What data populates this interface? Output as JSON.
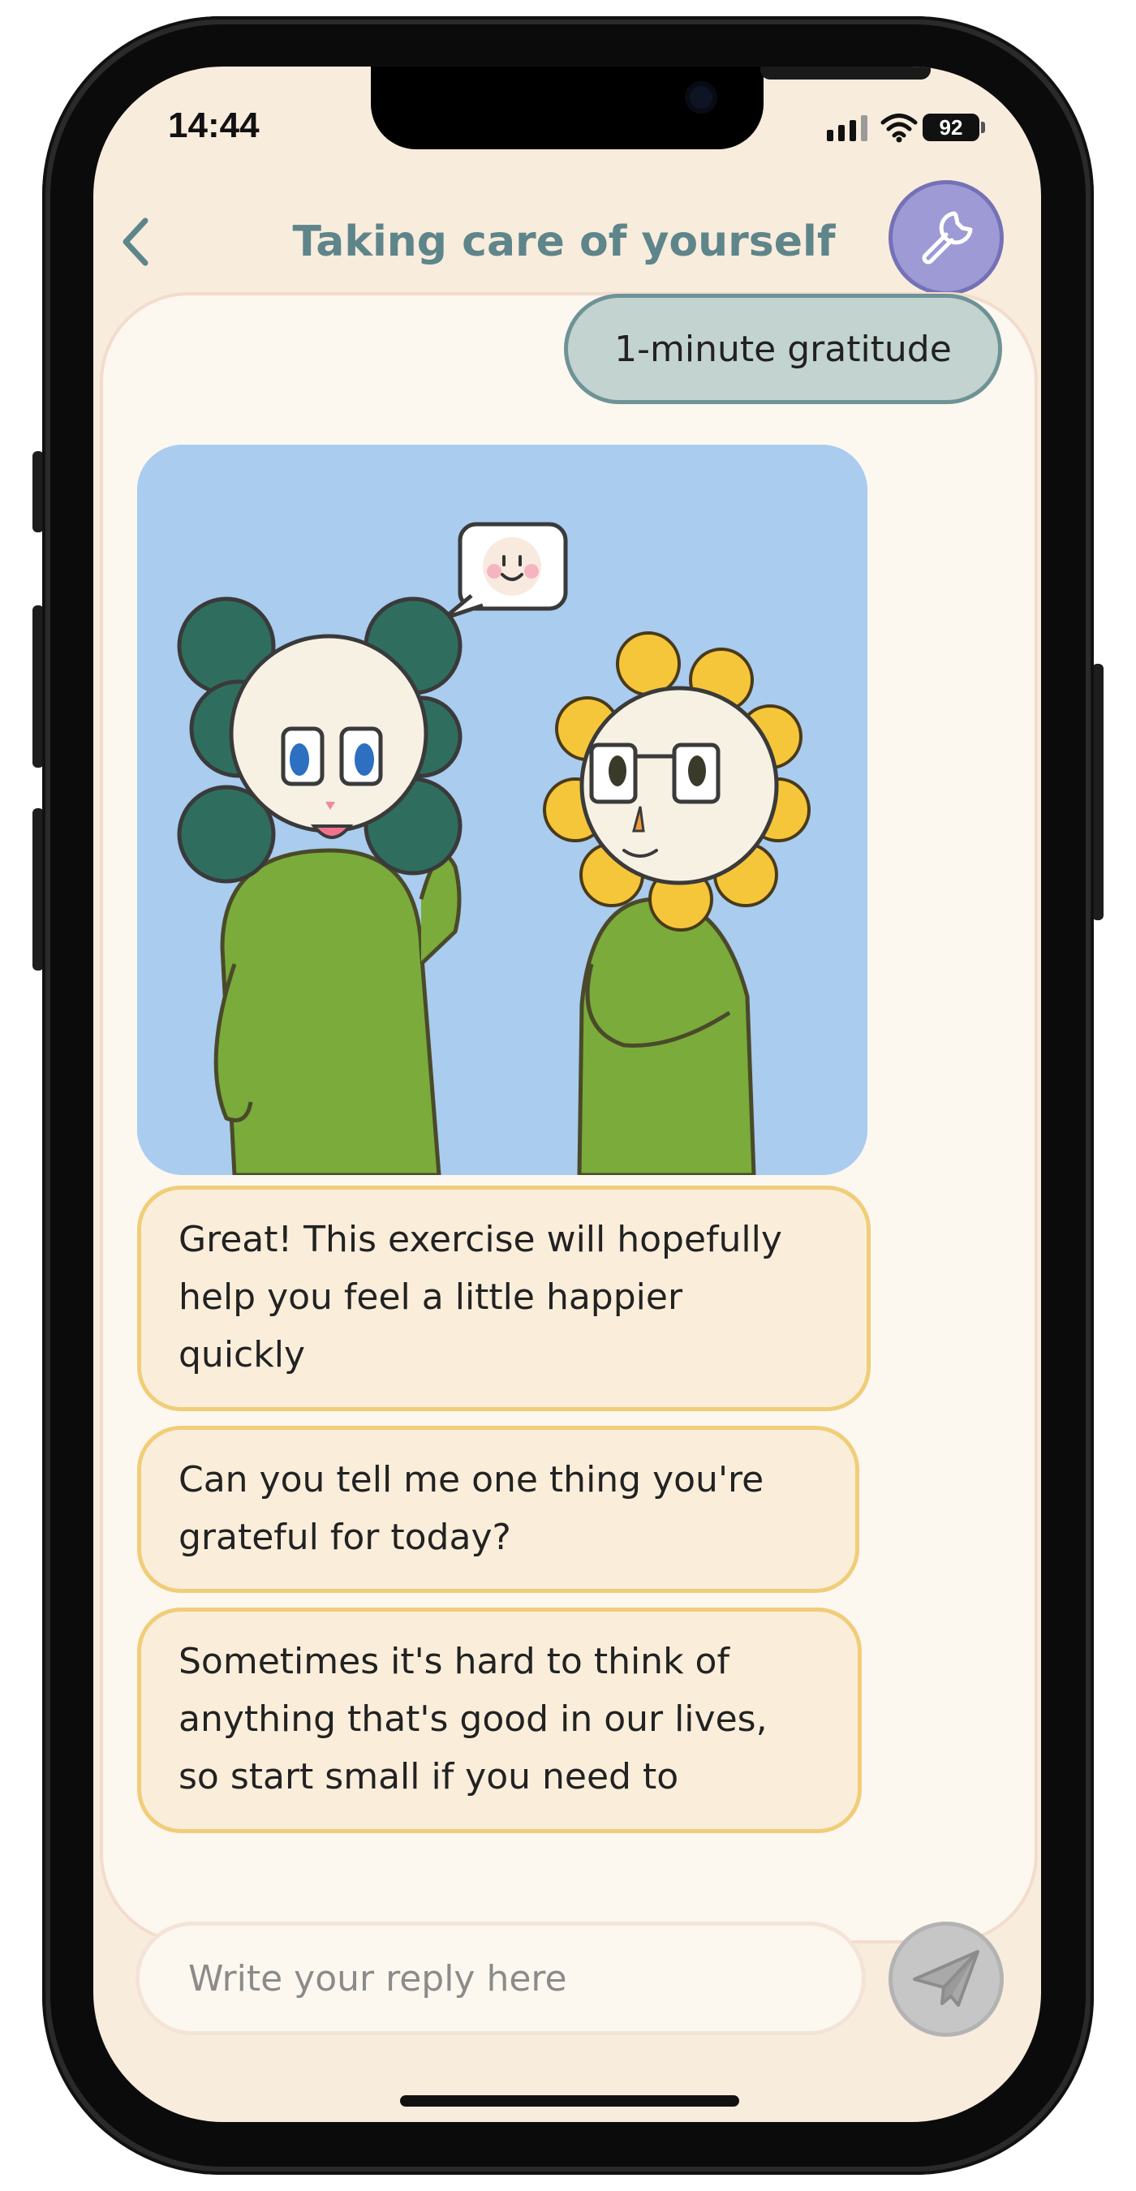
{
  "status_bar": {
    "time": "14:44",
    "battery": "92",
    "icons": [
      "cellular-signal-icon",
      "wifi-icon",
      "battery-icon"
    ]
  },
  "header": {
    "title": "Taking care of yourself",
    "back_icon": "chevron-left-icon",
    "tools_icon": "wrench-icon"
  },
  "chat": {
    "user_message": "1-minute gratitude",
    "image_speech_icon": "smiley-speech-bubble-icon",
    "bot_messages": [
      {
        "lines": [
          "Great! This exercise will hopefully",
          "help you feel a little happier",
          "quickly"
        ]
      },
      {
        "lines": [
          "Can you tell me one thing you're",
          "grateful for today?"
        ]
      },
      {
        "lines": [
          "Sometimes it's hard to think of",
          "anything that's good in our lives,",
          "so start small if you need to"
        ]
      }
    ]
  },
  "composer": {
    "placeholder": "Write your reply here",
    "send_icon": "paper-plane-icon"
  },
  "colors": {
    "screen_bg": "#f8ecdd",
    "title": "#5e858a",
    "tools_button": "#9d9ad6",
    "user_bubble": "#c3d3cf",
    "user_bubble_border": "#6e9396",
    "bot_bubble": "#faeedb",
    "bot_bubble_border": "#f1cd79",
    "image_bg": "#a9ccef",
    "send_button": "#c6c6c6"
  }
}
